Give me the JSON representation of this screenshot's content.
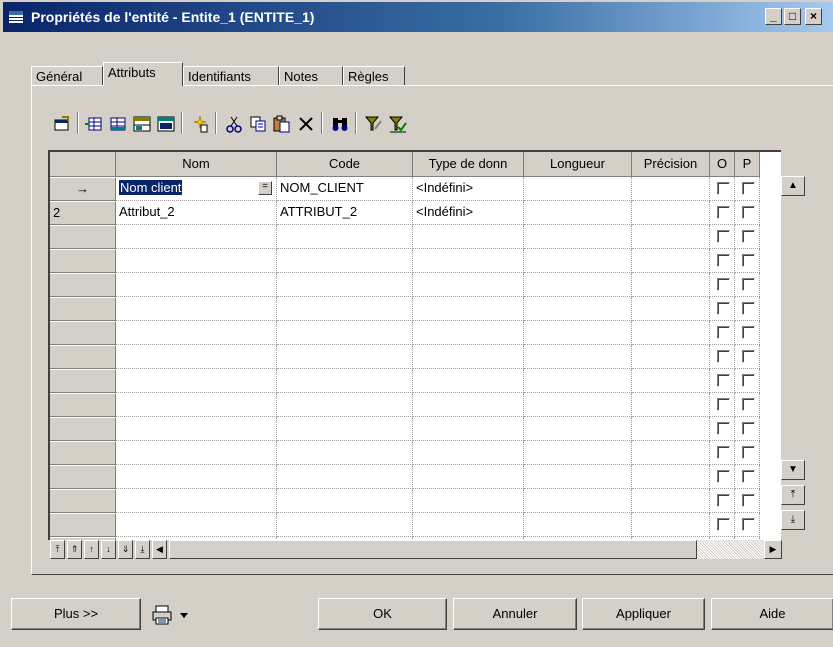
{
  "window": {
    "title": "Propriétés de l'entité - Entite_1 (ENTITE_1)"
  },
  "tabs": [
    {
      "label": "Général"
    },
    {
      "label": "Attributs"
    },
    {
      "label": "Identifiants"
    },
    {
      "label": "Notes"
    },
    {
      "label": "Règles"
    }
  ],
  "toolbar": {
    "icons": [
      "properties-icon",
      "insert-row-icon",
      "add-row-icon",
      "add-attributes-icon",
      "reuse-attributes-icon",
      "new-icon",
      "cut-icon",
      "copy-icon",
      "paste-icon",
      "delete-icon",
      "find-icon",
      "filter-icon",
      "customize-columns-icon"
    ]
  },
  "grid": {
    "columns": [
      "Nom",
      "Code",
      "Type de donn",
      "Longueur",
      "Précision",
      "O",
      "P"
    ],
    "rows": [
      {
        "row_header": "→",
        "name": "Nom client",
        "code": "NOM_CLIENT",
        "type": "<Indéfini>",
        "length": "",
        "precision": ""
      },
      {
        "row_header": "2",
        "name": "Attribut_2",
        "code": "ATTRIBUT_2",
        "type": "<Indéfini>",
        "length": "",
        "precision": ""
      }
    ],
    "cell_button": "="
  },
  "buttons": {
    "more": "Plus >>",
    "ok": "OK",
    "cancel": "Annuler",
    "apply": "Appliquer",
    "help": "Aide"
  }
}
